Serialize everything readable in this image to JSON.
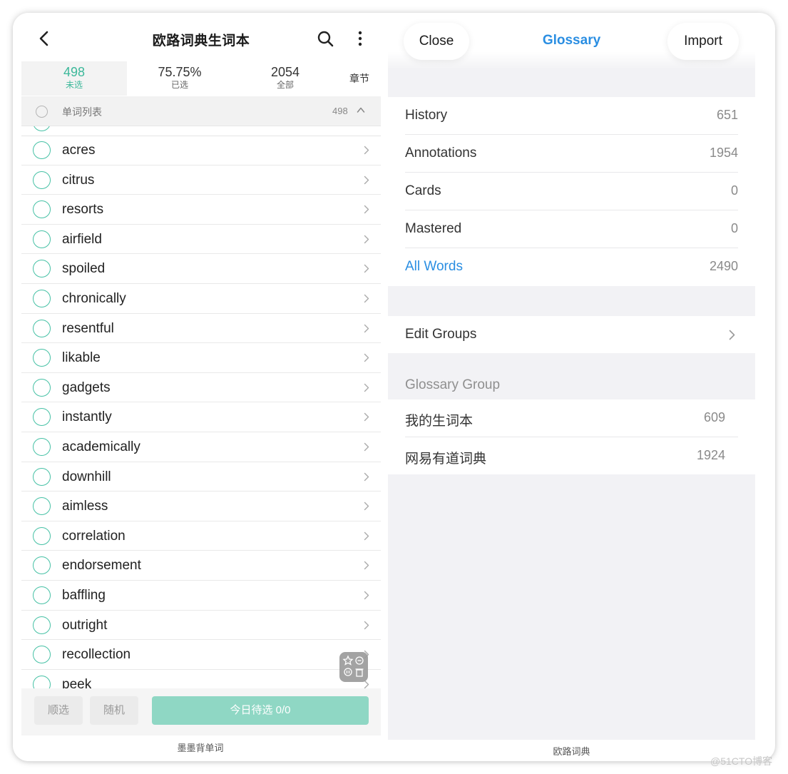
{
  "left": {
    "title": "欧路词典生词本",
    "stats": [
      {
        "num": "498",
        "label": "未选"
      },
      {
        "num": "75.75%",
        "label": "已选"
      },
      {
        "num": "2054",
        "label": "全部"
      }
    ],
    "chapter_label": "章节",
    "list_header": {
      "label": "单词列表",
      "count": "498"
    },
    "words": [
      "acres",
      "citrus",
      "resorts",
      "airfield",
      "spoiled",
      "chronically",
      "resentful",
      "likable",
      "gadgets",
      "instantly",
      "academically",
      "downhill",
      "aimless",
      "correlation",
      "endorsement",
      "baffling",
      "outright",
      "recollection",
      "peek"
    ],
    "footer": {
      "sequential": "顺选",
      "random": "随机",
      "today": "今日待选 0/0"
    },
    "caption": "墨墨背单词"
  },
  "right": {
    "close": "Close",
    "title": "Glossary",
    "import": "Import",
    "stats_rows": [
      {
        "label": "History",
        "value": "651"
      },
      {
        "label": "Annotations",
        "value": "1954"
      },
      {
        "label": "Cards",
        "value": "0"
      },
      {
        "label": "Mastered",
        "value": "0"
      },
      {
        "label": "All Words",
        "value": "2490"
      }
    ],
    "edit_groups": "Edit Groups",
    "group_title": "Glossary Group",
    "groups": [
      {
        "label": "我的生词本",
        "value": "609"
      },
      {
        "label": "网易有道词典",
        "value": "1924"
      }
    ],
    "caption": "欧路词典"
  },
  "watermark": "@51CTO博客",
  "colors": {
    "accent_green": "#46c1a5",
    "button_green": "#8fd7c4",
    "accent_blue": "#2a8ee2"
  }
}
